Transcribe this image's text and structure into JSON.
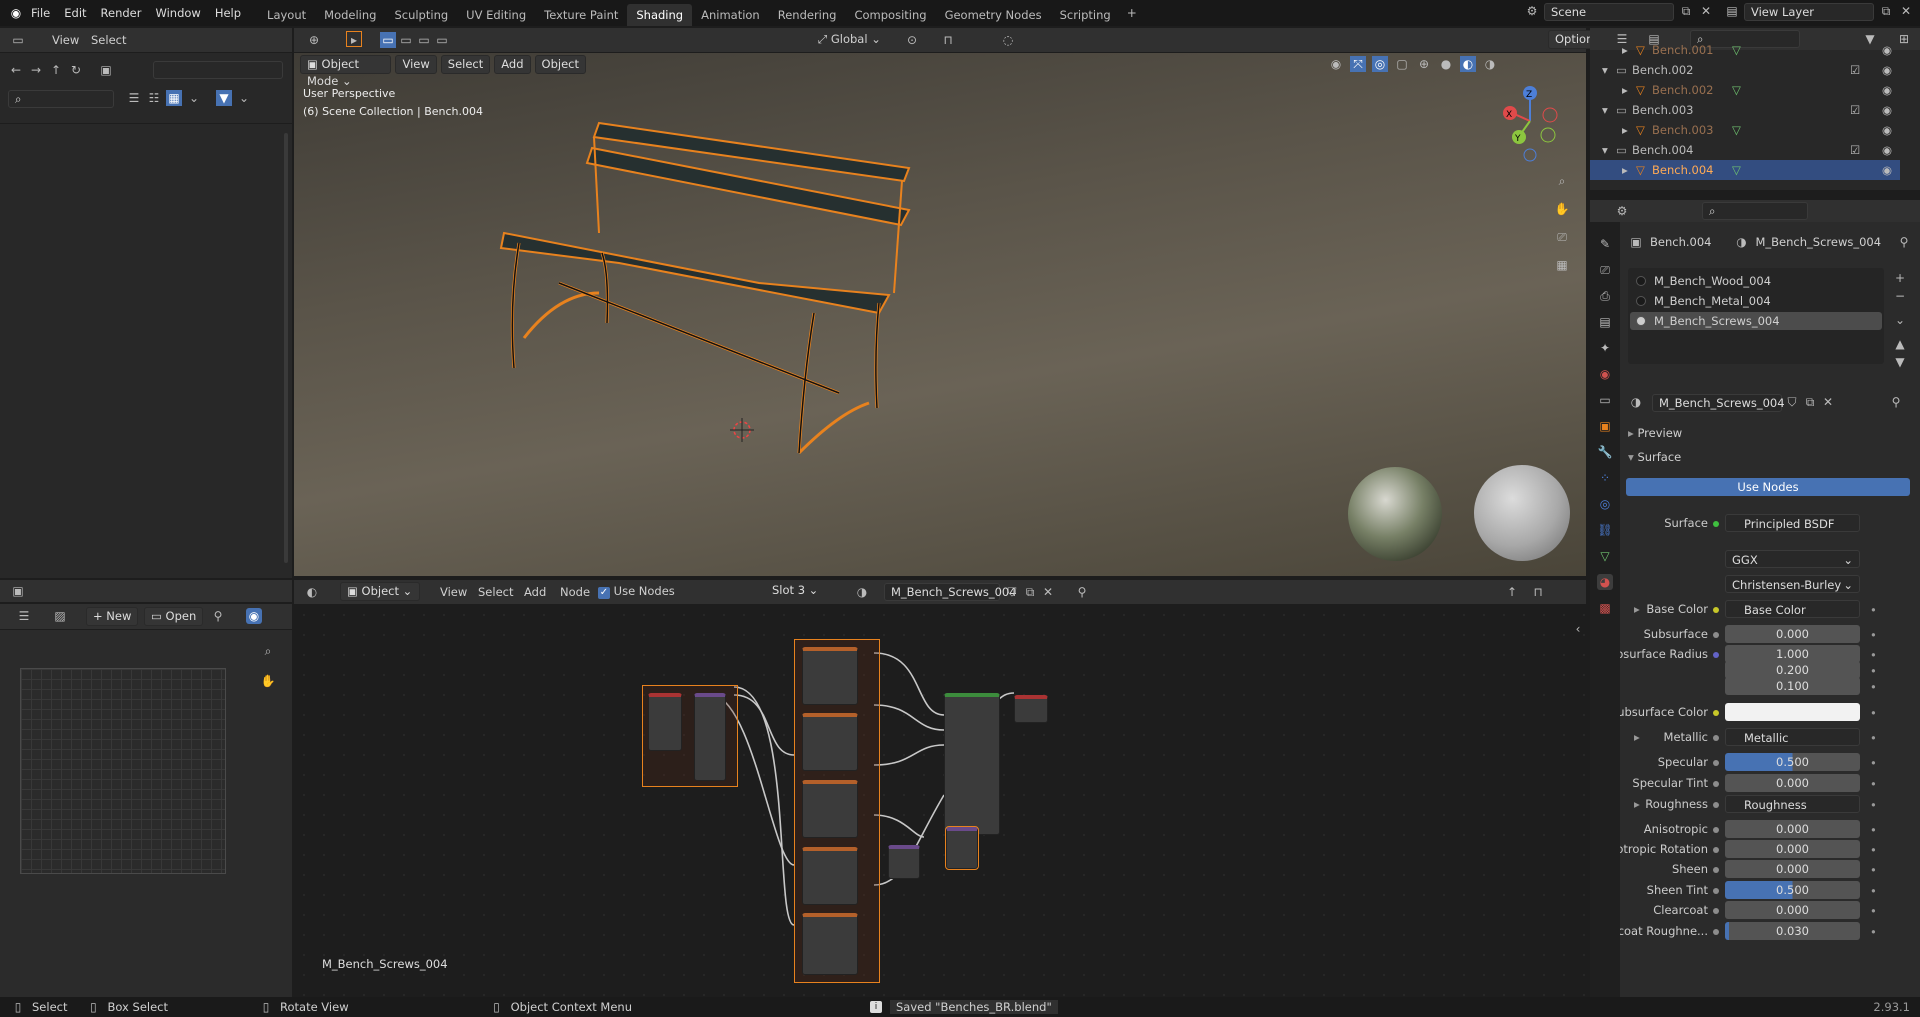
{
  "menu": [
    "File",
    "Edit",
    "Render",
    "Window",
    "Help"
  ],
  "workspaces": [
    "Layout",
    "Modeling",
    "Sculpting",
    "UV Editing",
    "Texture Paint",
    "Shading",
    "Animation",
    "Rendering",
    "Compositing",
    "Geometry Nodes",
    "Scripting"
  ],
  "active_workspace": "Shading",
  "scene": "Scene",
  "view_layer": "View Layer",
  "file_browser": {
    "menus": [
      "View",
      "Select"
    ]
  },
  "viewport": {
    "mode": "Object Mode",
    "menus": [
      "View",
      "Select",
      "Add",
      "Object"
    ],
    "transform": "Global",
    "options": "Options",
    "overlay1": "User Perspective",
    "overlay2": "(6) Scene Collection | Bench.004"
  },
  "image_editor": {
    "new": "New",
    "open": "Open"
  },
  "node_editor": {
    "type": "Object",
    "menus": [
      "View",
      "Select",
      "Add",
      "Node"
    ],
    "use_nodes": "Use Nodes",
    "slot": "Slot 3",
    "material": "M_Bench_Screws_004",
    "label": "M_Bench_Screws_004"
  },
  "outliner": {
    "rows": [
      {
        "name": "Bench.001",
        "indent": 2,
        "kind": "mesh"
      },
      {
        "name": "Bench.002",
        "indent": 1,
        "kind": "object"
      },
      {
        "name": "Bench.002",
        "indent": 2,
        "kind": "mesh"
      },
      {
        "name": "Bench.003",
        "indent": 1,
        "kind": "object"
      },
      {
        "name": "Bench.003",
        "indent": 2,
        "kind": "mesh"
      },
      {
        "name": "Bench.004",
        "indent": 1,
        "kind": "object"
      },
      {
        "name": "Bench.004",
        "indent": 2,
        "kind": "mesh",
        "selected": true
      }
    ]
  },
  "properties": {
    "object": "Bench.004",
    "material": "M_Bench_Screws_004",
    "slots": [
      "M_Bench_Wood_004",
      "M_Bench_Metal_004",
      "M_Bench_Screws_004"
    ],
    "active_slot": 2,
    "material_name": "M_Bench_Screws_004",
    "preview": "Preview",
    "surface_panel": "Surface",
    "use_nodes": "Use Nodes",
    "surface_label": "Surface",
    "surface_value": "Principled BSDF",
    "distribution": "GGX",
    "sss_method": "Christensen-Burley",
    "rows": [
      {
        "label": "Base Color",
        "value": "Base Color",
        "link": true,
        "dot": "#c7c729"
      },
      {
        "label": "Subsurface",
        "value": "0.000"
      },
      {
        "label": "Subsurface Radius",
        "value": "1.000",
        "dot": "#6363c7"
      },
      {
        "label": "",
        "value": "0.200",
        "nodot": true
      },
      {
        "label": "",
        "value": "0.100",
        "nodot": true
      },
      {
        "label": "Subsurface Color",
        "value": "",
        "color": true,
        "dot": "#c7c729"
      },
      {
        "label": "Metallic",
        "value": "Metallic",
        "link": true
      },
      {
        "label": "Specular",
        "value": "0.500",
        "fill": 0.5
      },
      {
        "label": "Specular Tint",
        "value": "0.000"
      },
      {
        "label": "Roughness",
        "value": "Roughness",
        "link": true
      },
      {
        "label": "Anisotropic",
        "value": "0.000"
      },
      {
        "label": "Anisotropic Rotation",
        "value": "0.000"
      },
      {
        "label": "Sheen",
        "value": "0.000"
      },
      {
        "label": "Sheen Tint",
        "value": "0.500",
        "fill": 0.5
      },
      {
        "label": "Clearcoat",
        "value": "0.000"
      },
      {
        "label": "Clearcoat Roughne...",
        "value": "0.030",
        "fill": 0.03
      }
    ]
  },
  "status": {
    "select": "Select",
    "box": "Box Select",
    "rotate": "Rotate View",
    "context": "Object Context Menu",
    "saved": "Saved \"Benches_BR.blend\"",
    "version": "2.93.1"
  },
  "colors": {
    "accent": "#4772b3",
    "selection": "#e8821e",
    "header": "#303030",
    "area": "#282828"
  }
}
